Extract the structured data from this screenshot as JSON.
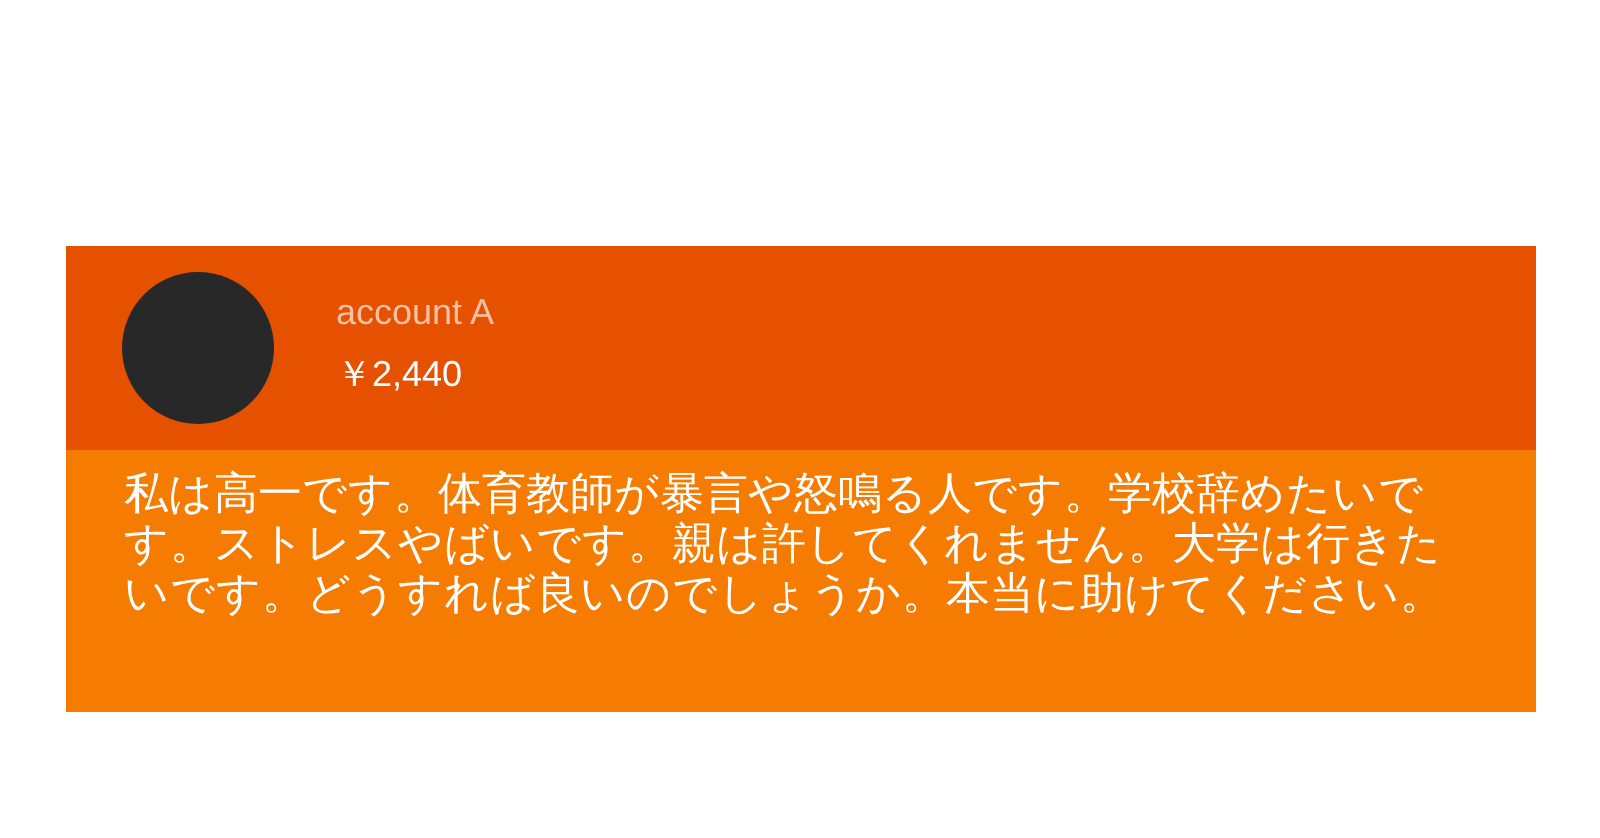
{
  "super_chat": {
    "author": "account A",
    "amount": "￥2,440",
    "message": "私は高一です。体育教師が暴言や怒鳴る人です。学校辞めたいです。ストレスやばいです。親は許してくれません。大学は行きたいです。どうすれば良いのでしょうか。本当に助けてください。"
  }
}
